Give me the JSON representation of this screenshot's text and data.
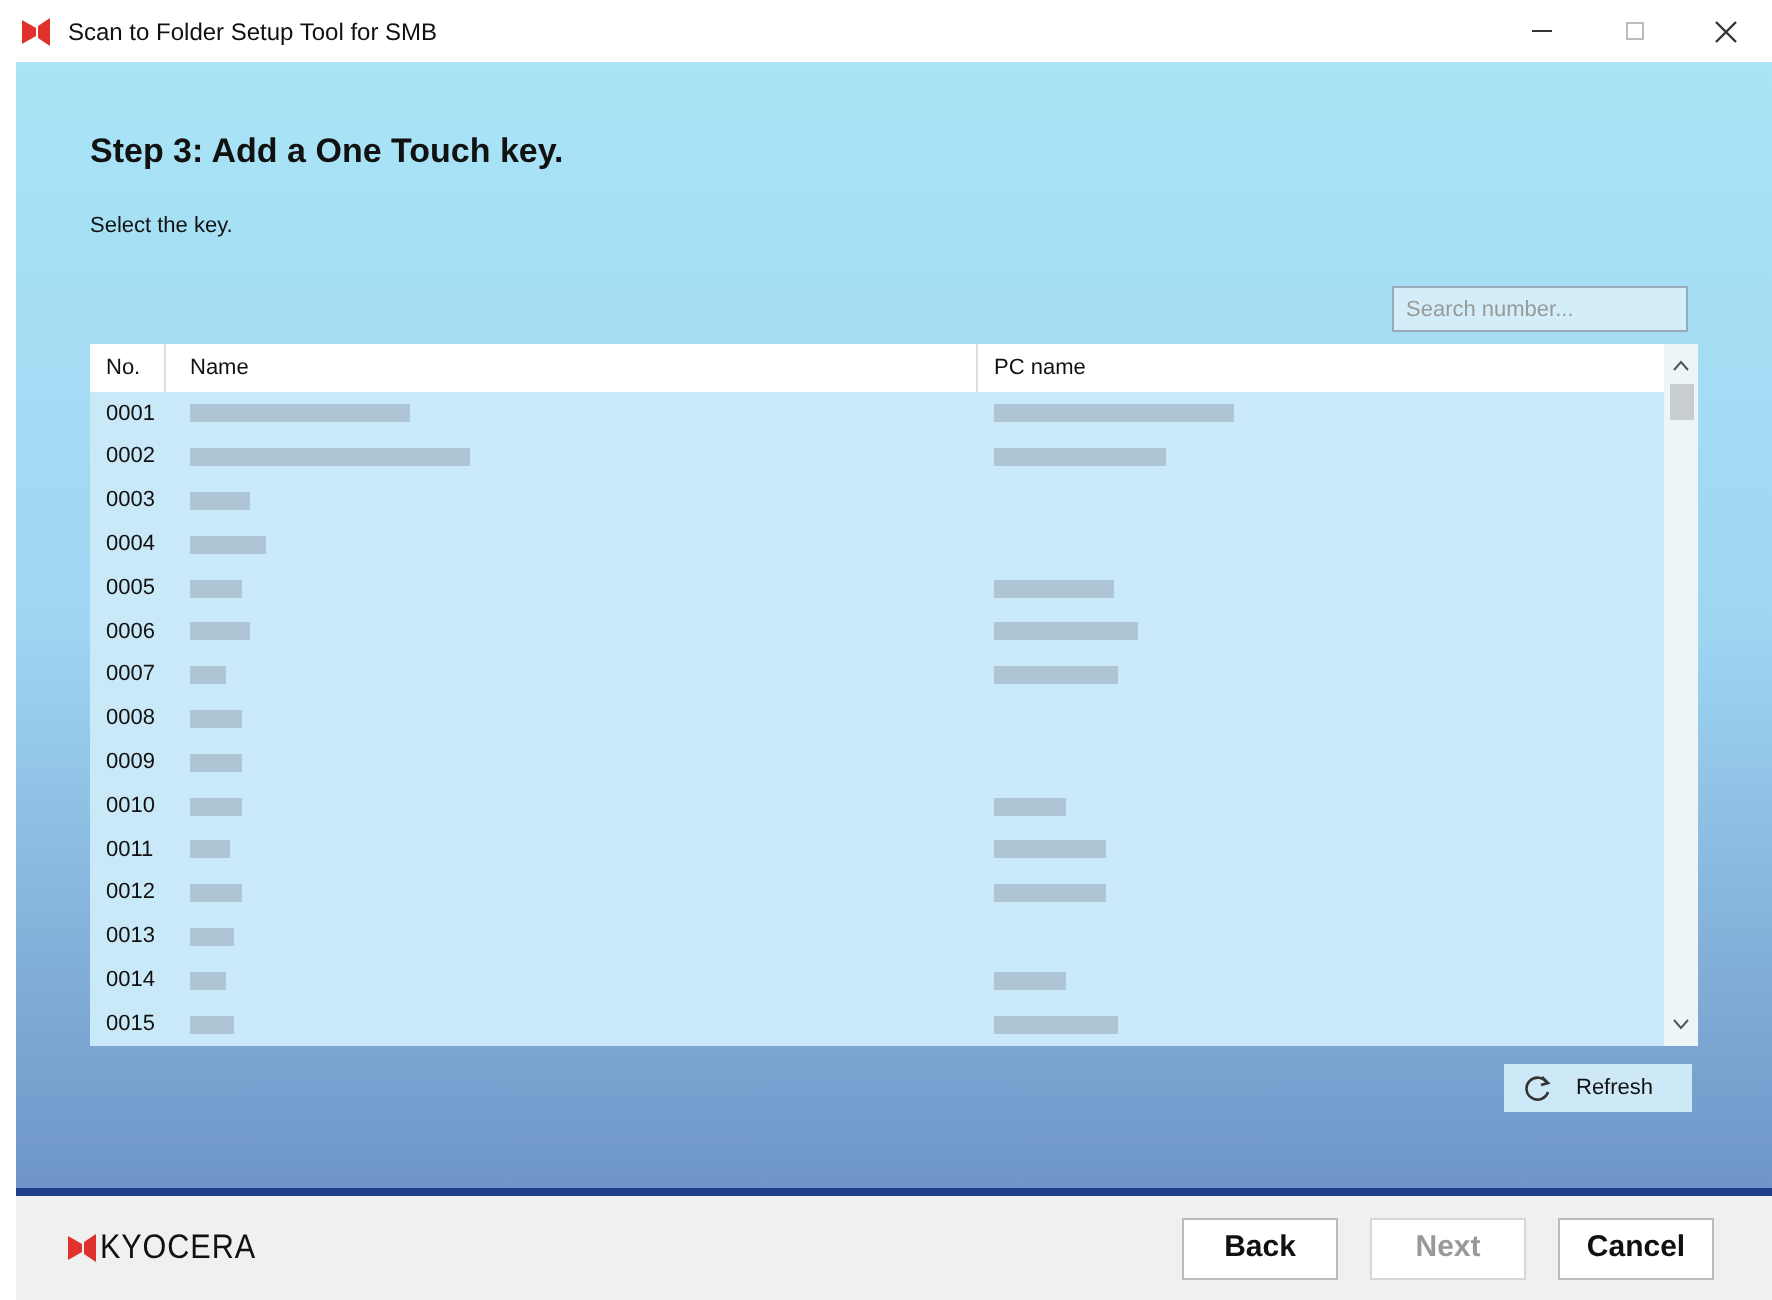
{
  "window": {
    "title": "Scan to Folder Setup Tool for SMB"
  },
  "heading": "Step 3: Add a One Touch key.",
  "instruction": "Select the key.",
  "search": {
    "placeholder": "Search number..."
  },
  "table": {
    "columns": [
      "No.",
      "Name",
      "PC name"
    ],
    "rows": [
      {
        "no": "0001",
        "pc_name_shown": true
      },
      {
        "no": "0002",
        "pc_name_shown": true
      },
      {
        "no": "0003",
        "pc_name_shown": false
      },
      {
        "no": "0004",
        "pc_name_shown": false
      },
      {
        "no": "0005",
        "pc_name_shown": true
      },
      {
        "no": "0006",
        "pc_name_shown": true
      },
      {
        "no": "0007",
        "pc_name_shown": true
      },
      {
        "no": "0008",
        "pc_name_shown": false
      },
      {
        "no": "0009",
        "pc_name_shown": false
      },
      {
        "no": "0010",
        "pc_name_shown": true
      },
      {
        "no": "0011",
        "pc_name_shown": true
      },
      {
        "no": "0012",
        "pc_name_shown": true
      },
      {
        "no": "0013",
        "pc_name_shown": false
      },
      {
        "no": "0014",
        "pc_name_shown": true
      },
      {
        "no": "0015",
        "pc_name_shown": true
      }
    ]
  },
  "refresh_button": "Refresh",
  "footer": {
    "logo": "KYOCERA",
    "buttons": [
      {
        "label": "Back",
        "disabled": false
      },
      {
        "label": "Next",
        "disabled": true
      },
      {
        "label": "Cancel",
        "disabled": false
      }
    ]
  }
}
